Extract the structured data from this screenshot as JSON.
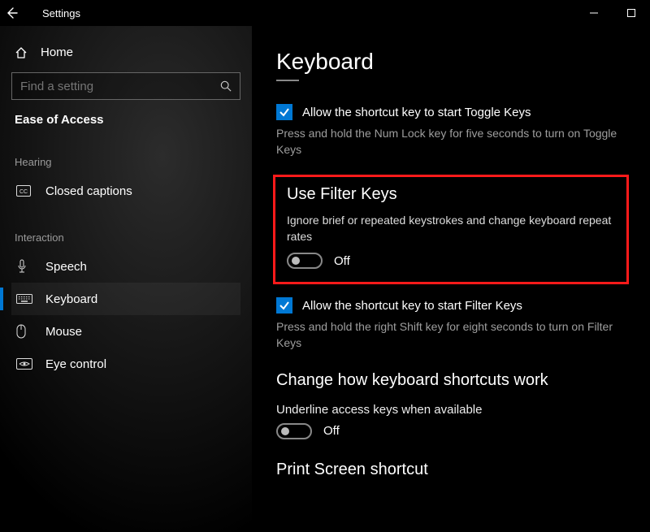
{
  "window": {
    "app_title": "Settings"
  },
  "sidebar": {
    "home_label": "Home",
    "search_placeholder": "Find a setting",
    "section_title": "Ease of Access",
    "groups": {
      "hearing": {
        "label": "Hearing"
      },
      "interaction": {
        "label": "Interaction"
      }
    },
    "items": {
      "closed_captions": "Closed captions",
      "speech": "Speech",
      "keyboard": "Keyboard",
      "mouse": "Mouse",
      "eye_control": "Eye control"
    }
  },
  "content": {
    "page_title": "Keyboard",
    "toggle_keys": {
      "checkbox_label": "Allow the shortcut key to start Toggle Keys",
      "desc": "Press and hold the Num Lock key for five seconds to turn on Toggle Keys"
    },
    "filter_keys": {
      "heading": "Use Filter Keys",
      "desc": "Ignore brief or repeated keystrokes and change keyboard repeat rates",
      "toggle_state": "Off",
      "shortcut_checkbox_label": "Allow the shortcut key to start Filter Keys",
      "shortcut_desc": "Press and hold the right Shift key for eight seconds to turn on Filter Keys"
    },
    "shortcuts_section": {
      "heading": "Change how keyboard shortcuts work",
      "underline_label": "Underline access keys when available",
      "underline_state": "Off"
    },
    "print_screen": {
      "heading": "Print Screen shortcut"
    }
  }
}
